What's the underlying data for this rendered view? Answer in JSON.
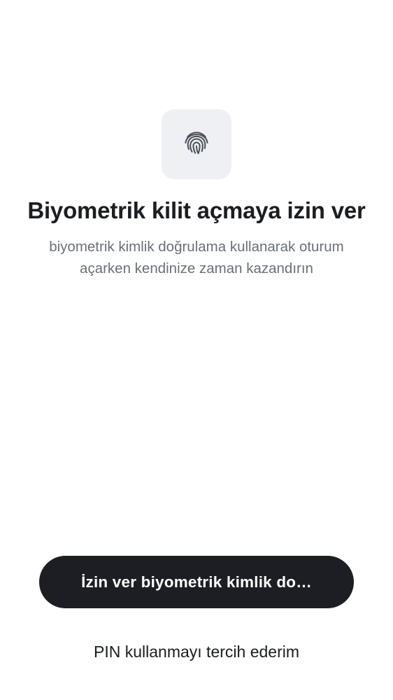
{
  "header": {
    "icon": "fingerprint-icon",
    "title": "Biyometrik kilit açmaya izin ver",
    "subtitle": "biyometrik kimlik doğrulama kullanarak oturum açarken kendinize zaman kazandırın"
  },
  "actions": {
    "primary_label": "İzin ver biyometrik kimlik do…",
    "secondary_label": "PIN kullanmayı tercih ederim"
  },
  "colors": {
    "background": "#ffffff",
    "icon_tile": "#eef0f3",
    "primary_button": "#1c1e23",
    "title_text": "#1b1d22",
    "subtitle_text": "#6a6f78"
  }
}
